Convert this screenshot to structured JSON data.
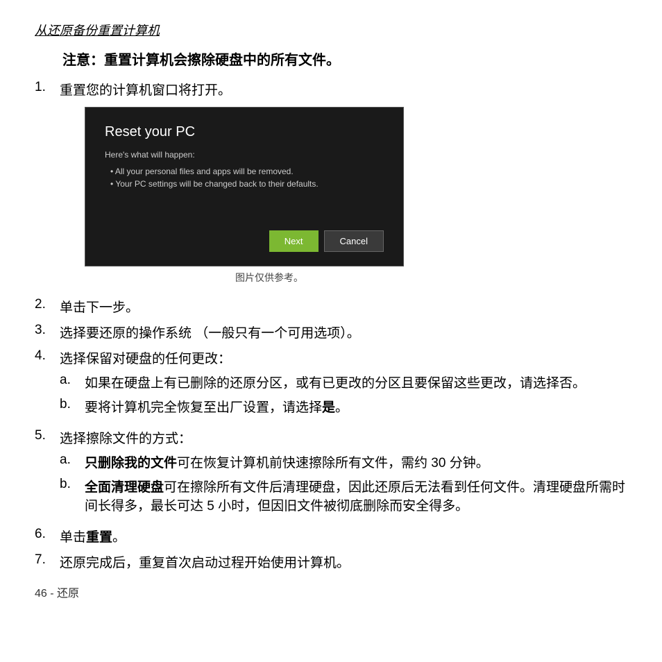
{
  "page": {
    "title": "从还原备份重置计算机",
    "warning": "注意：重置计算机会擦除硬盘中的所有文件。",
    "steps": [
      {
        "num": "1.",
        "text": "重置您的计算机窗口将打开。"
      },
      {
        "num": "2.",
        "text": "单击下一步。"
      },
      {
        "num": "3.",
        "text": "选择要还原的操作系统 （一般只有一个可用选项）。"
      },
      {
        "num": "4.",
        "text": "选择保留对硬盘的任何更改："
      },
      {
        "num": "5.",
        "text": "选择擦除文件的方式："
      },
      {
        "num": "6.",
        "text_prefix": "单击",
        "text_bold": "重置",
        "text_suffix": "。"
      },
      {
        "num": "7.",
        "text": "还原完成后，重复首次启动过程开始使用计算机。"
      }
    ],
    "screenshot": {
      "title": "Reset your PC",
      "subtitle": "Here's what will happen:",
      "bullets": [
        "All your personal files and apps will be removed.",
        "Your PC settings will be changed back to their defaults."
      ],
      "btn_next": "Next",
      "btn_cancel": "Cancel"
    },
    "image_caption": "图片仅供参考。",
    "step4_subs": [
      {
        "label": "a.",
        "text": "如果在硬盘上有已删除的还原分区，或有已更改的分区且要保留这些更改，请选择否。"
      },
      {
        "label": "b.",
        "text_prefix": "要将计算机完全恢复至出厂设置，请选择",
        "text_bold": "是",
        "text_suffix": "。"
      }
    ],
    "step5_subs": [
      {
        "label": "a.",
        "text_bold": "只删除我的文件",
        "text_suffix": "可在恢复计算机前快速擦除所有文件，需约 30 分钟。"
      },
      {
        "label": "b.",
        "text_bold": "全面清理硬盘",
        "text_suffix": "可在擦除所有文件后清理硬盘，因此还原后无法看到任何文件。清理硬盘所需时间长得多，最长可达 5 小时，但因旧文件被彻底删除而安全得多。"
      }
    ],
    "footer": "46 - 还原"
  }
}
